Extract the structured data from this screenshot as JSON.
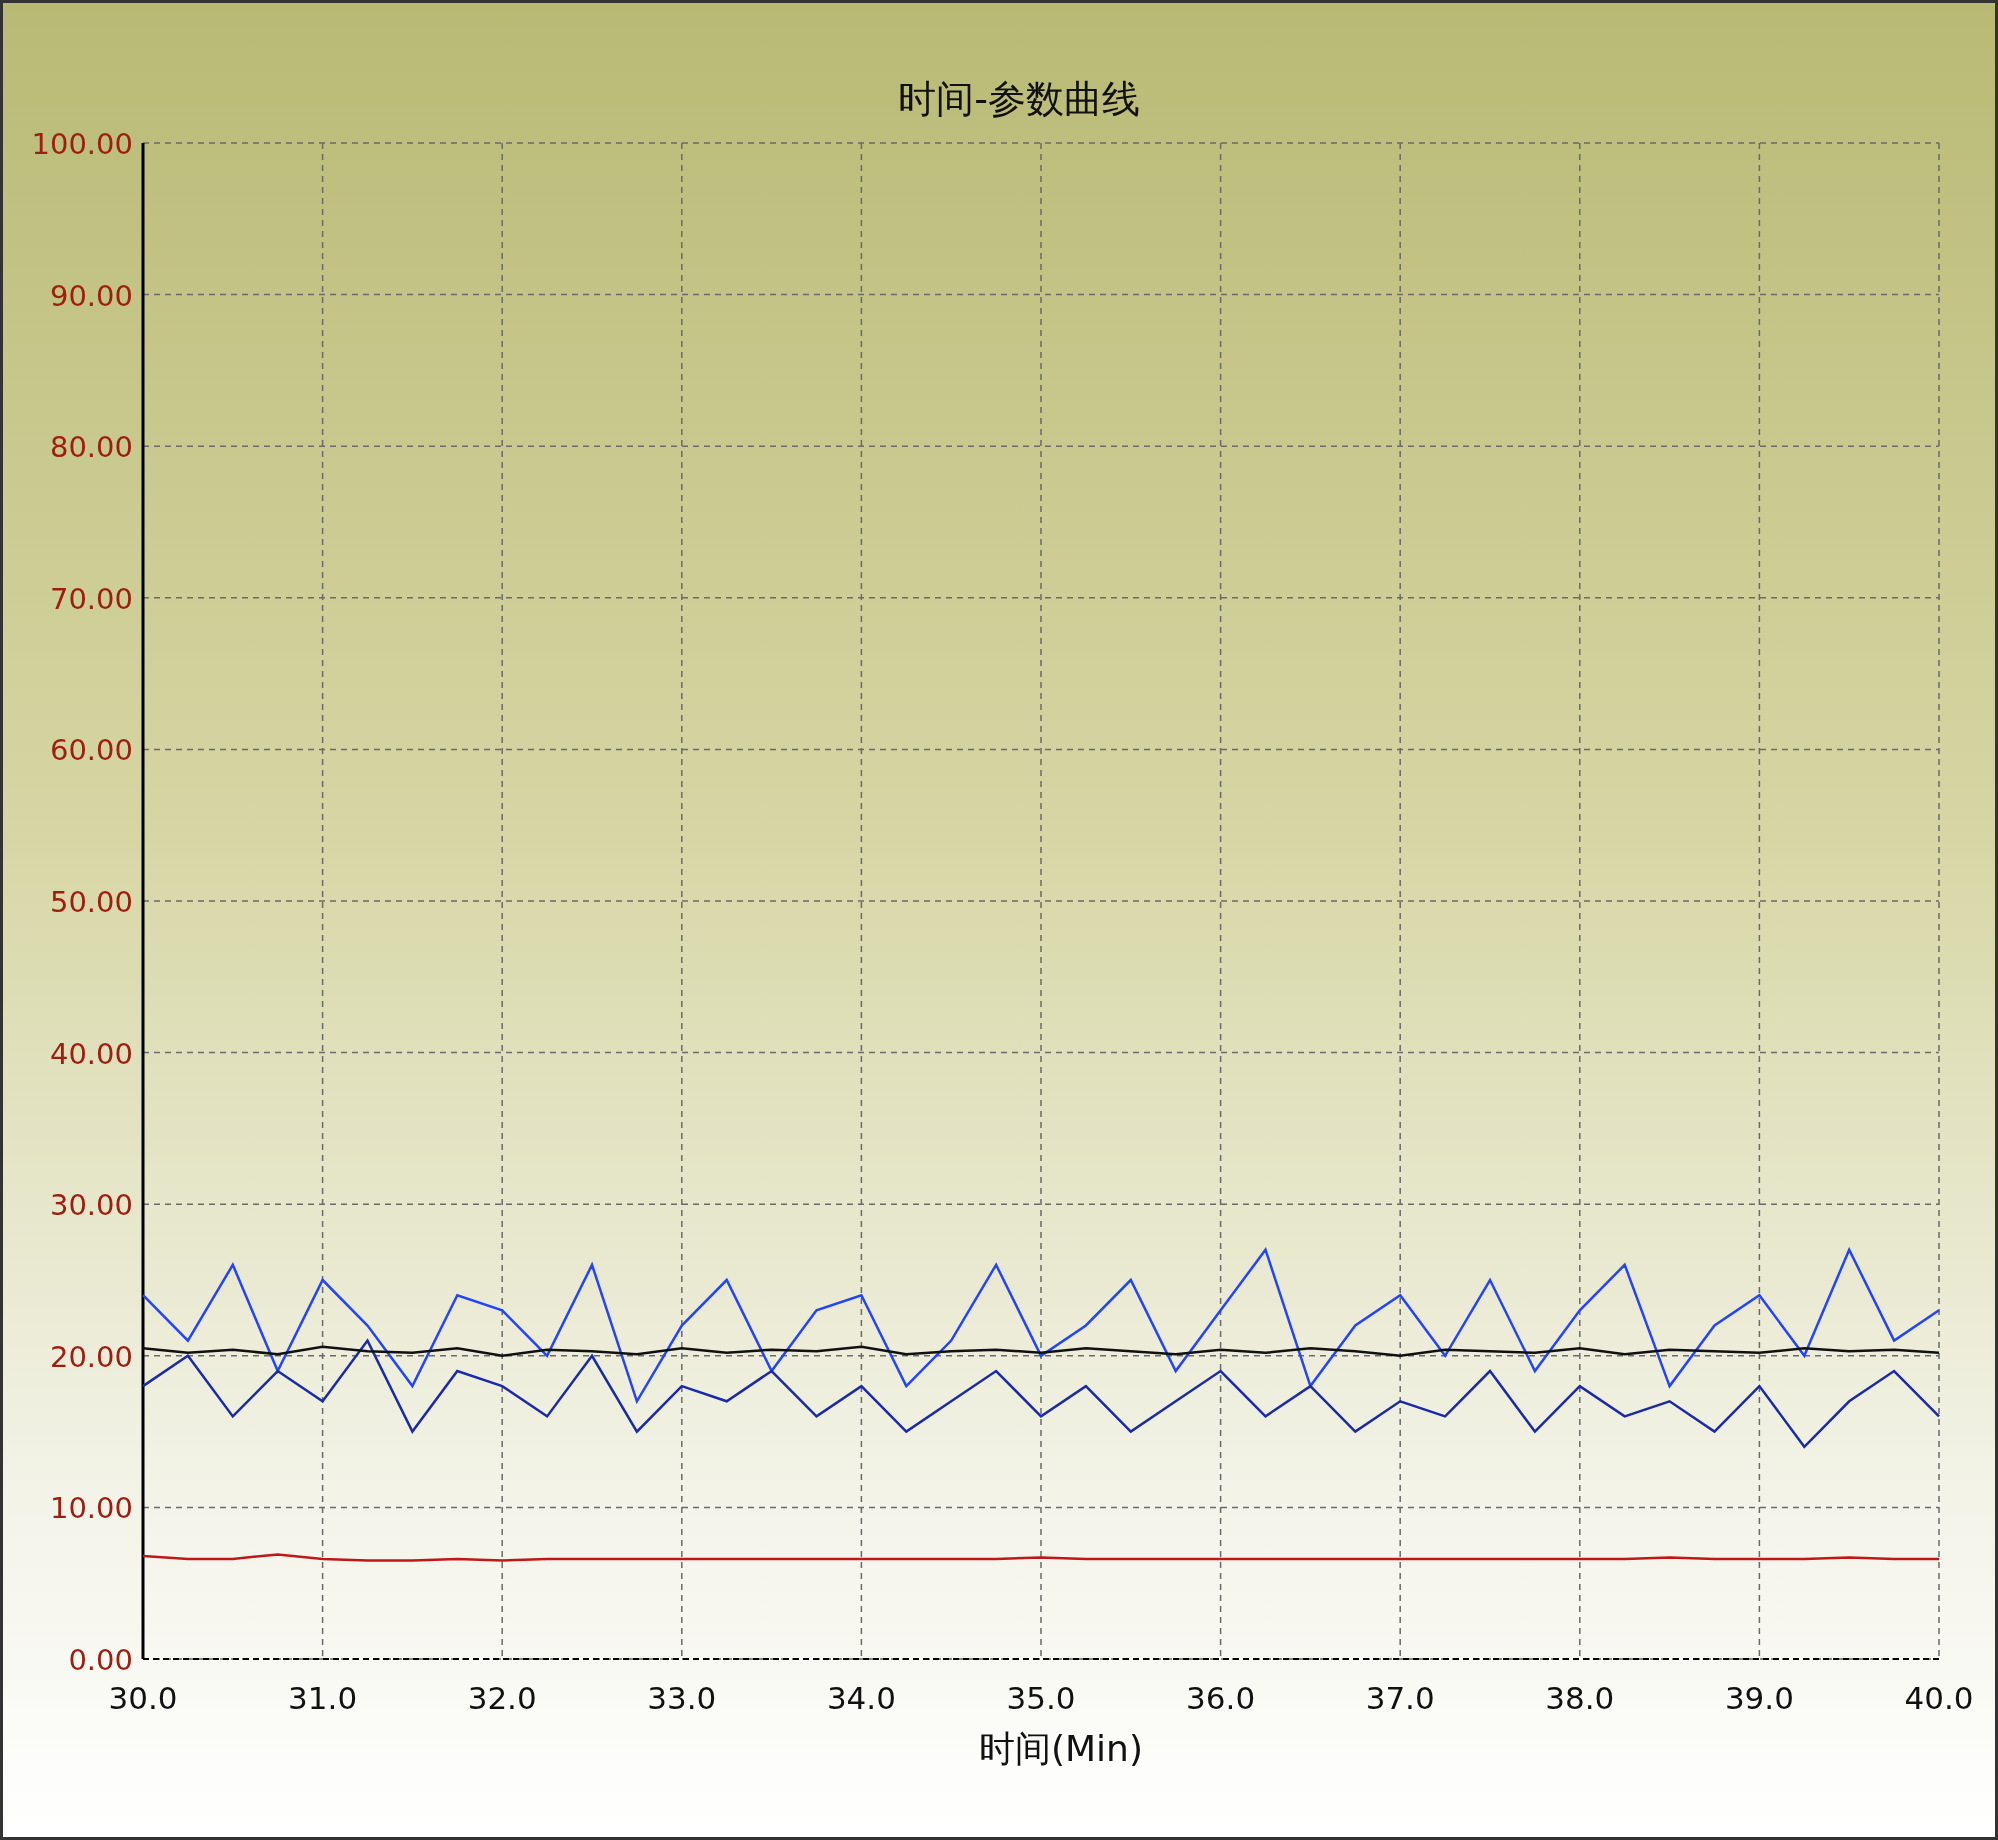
{
  "chart": {
    "chart_data": {
      "type": "line",
      "title": "时间-参数曲线",
      "xlabel": "时间(Min)",
      "x": [
        30,
        30.25,
        30.5,
        30.75,
        31,
        31.25,
        31.5,
        31.75,
        32,
        32.25,
        32.5,
        32.75,
        33,
        33.25,
        33.5,
        33.75,
        34,
        34.25,
        34.5,
        34.75,
        35,
        35.25,
        35.5,
        35.75,
        36,
        36.25,
        36.5,
        36.75,
        37,
        37.25,
        37.5,
        37.75,
        38,
        38.25,
        38.5,
        38.75,
        39,
        39.25,
        39.5,
        39.75,
        40
      ],
      "series": [
        {
          "color": "#2244ff",
          "values": [
            24,
            21,
            26,
            19,
            25,
            22,
            18,
            24,
            23,
            20,
            26,
            17,
            22,
            25,
            19,
            23,
            24,
            18,
            21,
            26,
            20,
            22,
            25,
            19,
            23,
            27,
            18,
            22,
            24,
            20,
            25,
            19,
            23,
            26,
            18,
            22,
            24,
            20,
            27,
            21,
            23
          ]
        },
        {
          "color": "#1a2aa8",
          "values": [
            18,
            20,
            16,
            19,
            17,
            21,
            15,
            19,
            18,
            16,
            20,
            15,
            18,
            17,
            19,
            16,
            18,
            15,
            17,
            19,
            16,
            18,
            15,
            17,
            19,
            16,
            18,
            15,
            17,
            16,
            19,
            15,
            18,
            16,
            17,
            15,
            18,
            14,
            17,
            19,
            16
          ]
        },
        {
          "color": "#111111",
          "values": [
            20.5,
            20.2,
            20.4,
            20.1,
            20.6,
            20.3,
            20.2,
            20.5,
            20.0,
            20.4,
            20.3,
            20.1,
            20.5,
            20.2,
            20.4,
            20.3,
            20.6,
            20.1,
            20.3,
            20.4,
            20.2,
            20.5,
            20.3,
            20.1,
            20.4,
            20.2,
            20.5,
            20.3,
            20.0,
            20.4,
            20.3,
            20.2,
            20.5,
            20.1,
            20.4,
            20.3,
            20.2,
            20.5,
            20.3,
            20.4,
            20.2
          ]
        },
        {
          "color": "#c01818",
          "values": [
            6.8,
            6.6,
            6.6,
            6.9,
            6.6,
            6.5,
            6.5,
            6.6,
            6.5,
            6.6,
            6.6,
            6.6,
            6.6,
            6.6,
            6.6,
            6.6,
            6.6,
            6.6,
            6.6,
            6.6,
            6.7,
            6.6,
            6.6,
            6.6,
            6.6,
            6.6,
            6.6,
            6.6,
            6.6,
            6.6,
            6.6,
            6.6,
            6.6,
            6.6,
            6.7,
            6.6,
            6.6,
            6.6,
            6.7,
            6.6,
            6.6
          ]
        }
      ],
      "grid": true,
      "xlim": [
        30,
        40
      ],
      "ylim": [
        0,
        100
      ],
      "xticks": [
        {
          "value": 30,
          "label": "30.0"
        },
        {
          "value": 31,
          "label": "31.0"
        },
        {
          "value": 32,
          "label": "32.0"
        },
        {
          "value": 33,
          "label": "33.0"
        },
        {
          "value": 34,
          "label": "34.0"
        },
        {
          "value": 35,
          "label": "35.0"
        },
        {
          "value": 36,
          "label": "36.0"
        },
        {
          "value": 37,
          "label": "37.0"
        },
        {
          "value": 38,
          "label": "38.0"
        },
        {
          "value": 39,
          "label": "39.0"
        },
        {
          "value": 40,
          "label": "40.0"
        }
      ],
      "yticks": [
        {
          "value": 0,
          "label": "0.00"
        },
        {
          "value": 10,
          "label": "10.00"
        },
        {
          "value": 20,
          "label": "20.00"
        },
        {
          "value": 30,
          "label": "30.00"
        },
        {
          "value": 40,
          "label": "40.00"
        },
        {
          "value": 50,
          "label": "50.00"
        },
        {
          "value": 60,
          "label": "60.00"
        },
        {
          "value": 70,
          "label": "70.00"
        },
        {
          "value": 80,
          "label": "80.00"
        },
        {
          "value": 90,
          "label": "90.00"
        },
        {
          "value": 100,
          "label": "100.00"
        }
      ]
    }
  }
}
